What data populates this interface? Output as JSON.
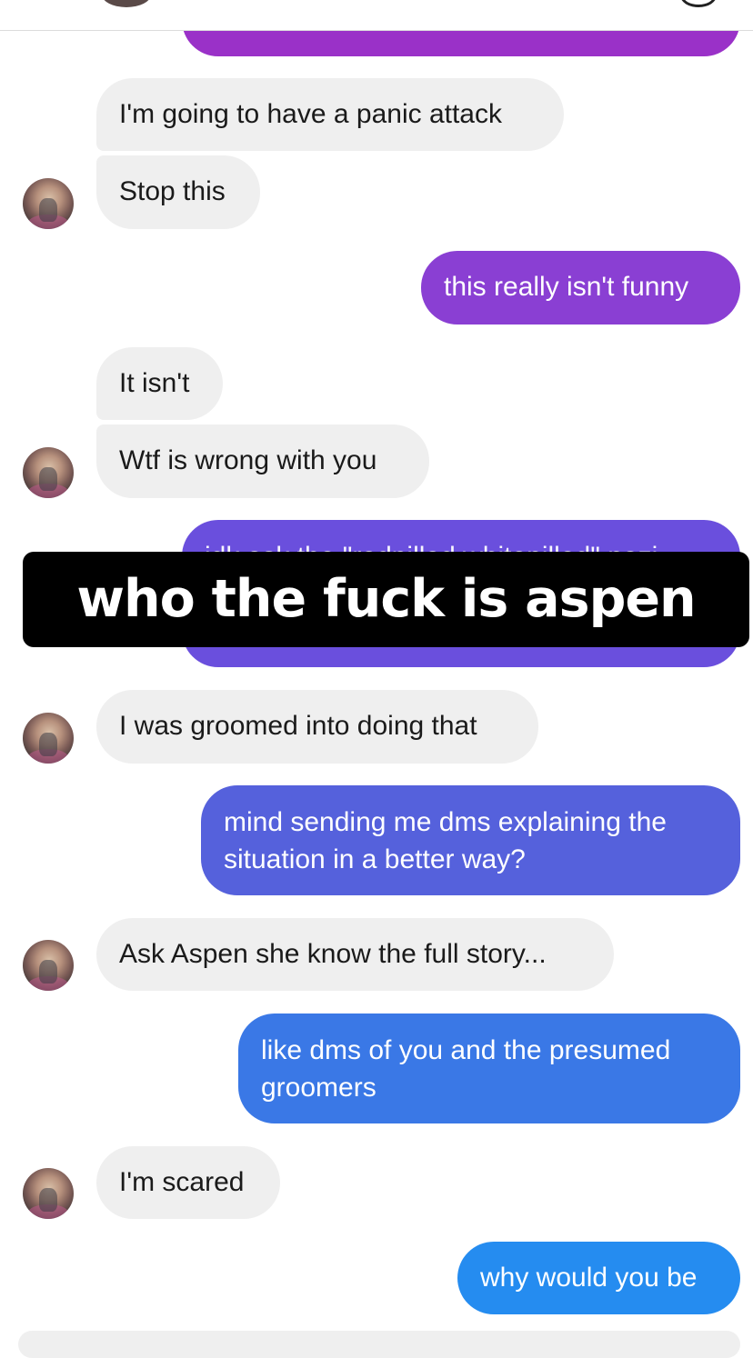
{
  "messages": [
    {
      "side": "out",
      "text": "",
      "color": "#9a31c8"
    },
    {
      "side": "in",
      "text": "I'm going to have a panic attack"
    },
    {
      "side": "in",
      "text": "Stop this"
    },
    {
      "side": "out",
      "text": "this really isn't funny",
      "color": "#8a3fd3"
    },
    {
      "side": "in",
      "text": "It isn't"
    },
    {
      "side": "in",
      "text": "Wtf is wrong with you"
    },
    {
      "side": "out",
      "text": "idk ask the \"redpilled whitepilled\" nazi",
      "color": "#6a4fdd"
    },
    {
      "side": "in",
      "text": "I was groomed into doing that"
    },
    {
      "side": "out",
      "text": "mind sending me dms explaining the situation in a better way?",
      "color": "#5561dc"
    },
    {
      "side": "in",
      "text": "Ask Aspen she know the full story..."
    },
    {
      "side": "out",
      "text": "like dms of you and the presumed groomers",
      "color": "#3a78e6"
    },
    {
      "side": "in",
      "text": "I'm scared"
    },
    {
      "side": "out",
      "text": "why would you be",
      "color": "#258cf0"
    }
  ],
  "overlay_caption": "who the fuck is aspen"
}
